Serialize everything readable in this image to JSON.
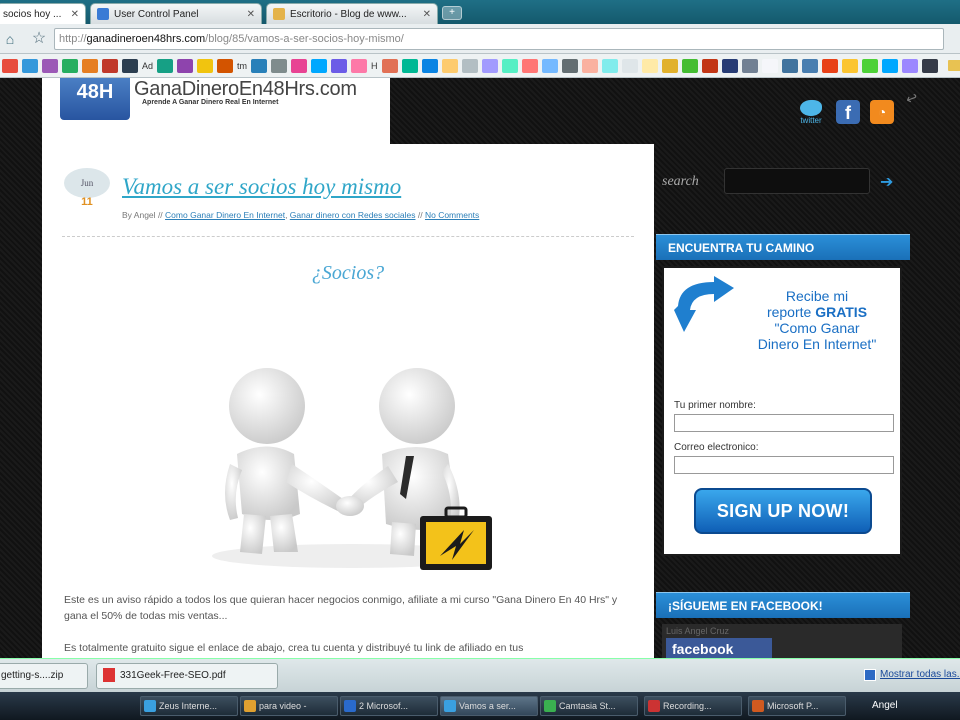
{
  "browser": {
    "tabs": [
      {
        "label": "socios hoy ...",
        "icon_color": "#2f86c8",
        "active": true
      },
      {
        "label": "User Control Panel",
        "icon_color": "#3a7bd5",
        "active": false
      },
      {
        "label": "Escritorio - Blog de www...",
        "icon_color": "#e4b34a",
        "active": false
      }
    ],
    "new_tab_label": "+",
    "url_scheme": "http://",
    "url_host": "ganadineroen48hrs.com",
    "url_path": "/blog/85/vamos-a-ser-socios-hoy-mismo/",
    "bookmarks": {
      "labels": [
        "Ad",
        "tm",
        "H"
      ],
      "icon_colors": [
        "#e74c3c",
        "#3498db",
        "#9b59b6",
        "#27ae60",
        "#e67e22",
        "#c0392b",
        "#2c3e50",
        "#16a085",
        "#8e44ad",
        "#f1c40f",
        "#d35400",
        "#2980b9",
        "#7f8c8d",
        "#e84393",
        "#00a8ff",
        "#6c5ce7",
        "#fd79a8",
        "#e17055",
        "#00b894",
        "#0984e3",
        "#fdcb6e",
        "#b2bec3",
        "#a29bfe",
        "#55efc4",
        "#ff7675",
        "#74b9ff",
        "#636e72",
        "#fab1a0",
        "#81ecec",
        "#dfe6e9",
        "#ffeaa7",
        "#e1b12c",
        "#44bd32",
        "#c23616",
        "#273c75",
        "#718093",
        "#f5f6fa",
        "#40739e",
        "#487eb0",
        "#e84118",
        "#fbc531",
        "#4cd137",
        "#00a8ff",
        "#9c88ff",
        "#353b48"
      ]
    }
  },
  "site": {
    "logo_badge": "48H",
    "logo_name": "GanaDineroEn48Hrs.com",
    "logo_tagline": "Aprende A Ganar Dinero Real En Internet",
    "social": {
      "twitter_label": "twitter",
      "facebook_glyph": "f",
      "rss_glyph": "◔"
    }
  },
  "post": {
    "date_month": "Jun",
    "date_day": "11",
    "title": "Vamos a ser socios hoy mismo",
    "meta_by": "By Angel",
    "meta_sep": "//",
    "meta_cat1": "Como Ganar Dinero En Internet",
    "meta_cat2": "Ganar dinero con Redes sociales",
    "meta_comments": "No Comments",
    "subtitle": "¿Socios?",
    "paragraph1": "Este es un aviso rápido a todos los que quieran hacer negocios conmigo, afiliate a mi curso \"Gana Dinero En 40 Hrs\" y gana el 50% de todas mis ventas...",
    "paragraph2": "Es totalmente gratuito sigue el enlace de abajo, crea tu cuenta y distribuyé tu link de afiliado en tus"
  },
  "sidebar": {
    "search_label": "search",
    "search_go": "➔",
    "widget1_title": "ENCUENTRA TU CAMINO",
    "optin_line1": "Recibe mi",
    "optin_line2_a": "reporte",
    "optin_line2_b": "GRATIS",
    "optin_line3": "\"Como Ganar",
    "optin_line4": "Dinero En Internet\"",
    "field1_label": "Tu primer nombre:",
    "field2_label": "Correo electronico:",
    "signup_label": "SIGN UP NOW!",
    "widget2_title": "¡SÍGUEME EN FACEBOOK!",
    "fb_name": "Luis Angel Cruz",
    "fb_logo": "facebook"
  },
  "downloads": {
    "item1": "getting-s....zip",
    "item2": "331Geek-Free-SEO.pdf",
    "show_all": "Mostrar todas las..."
  },
  "taskbar": {
    "items": [
      {
        "label": "Zeus Interne...",
        "icon": "#3aa0e0"
      },
      {
        "label": "para video -",
        "icon": "#e0a030"
      },
      {
        "label": "2 Microsof...",
        "icon": "#2a6acc"
      },
      {
        "label": "Vamos a ser...",
        "icon": "#3aa0e0"
      },
      {
        "label": "Camtasia St...",
        "icon": "#3ab050"
      },
      {
        "label": "Recording...",
        "icon": "#cc3333"
      },
      {
        "label": "Microsoft P...",
        "icon": "#d05a20"
      }
    ],
    "user": "Angel"
  }
}
